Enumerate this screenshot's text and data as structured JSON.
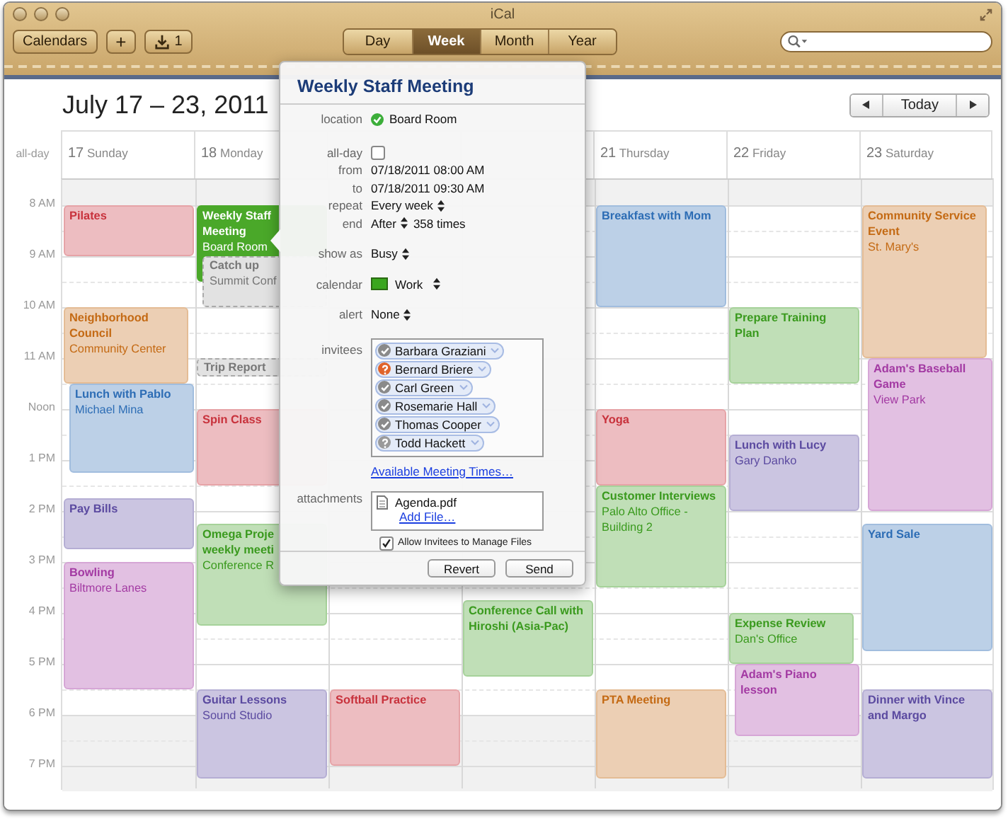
{
  "window": {
    "title": "iCal"
  },
  "toolbar": {
    "calendars": "Calendars",
    "add": "+",
    "inbox_count": "1",
    "views": [
      {
        "label": "Day",
        "selected": false
      },
      {
        "label": "Week",
        "selected": true
      },
      {
        "label": "Month",
        "selected": false
      },
      {
        "label": "Year",
        "selected": false
      }
    ]
  },
  "range_title": "July 17 – 23, 2011",
  "today": "Today",
  "allday_label": "all-day",
  "times": [
    "8 AM",
    "9 AM",
    "10 AM",
    "11 AM",
    "Noon",
    "1 PM",
    "2 PM",
    "3 PM",
    "4 PM",
    "5 PM",
    "6 PM",
    "7 PM"
  ],
  "days": [
    {
      "number": "17",
      "name": "Sunday",
      "events": [
        {
          "title": "Pilates",
          "color": "#c8323c",
          "kind": "normal"
        },
        {
          "title": "Neighborhood Council",
          "location": "Community Center",
          "color": "#c46a14",
          "kind": "normal"
        },
        {
          "title": "Lunch with Pablo",
          "location": "Michael Mina",
          "color": "#2d6db5",
          "kind": "normal"
        },
        {
          "title": "Pay Bills",
          "color": "#5b4aa0",
          "kind": "normal"
        },
        {
          "title": "Bowling",
          "location": "Biltmore Lanes",
          "color": "#a33aa3",
          "kind": "normal"
        }
      ]
    },
    {
      "number": "18",
      "name": "Monday",
      "events": [
        {
          "title": "Weekly Staff Meeting",
          "location": "Board Room",
          "color": "#4aa829",
          "kind": "selected"
        },
        {
          "title": "Catch up",
          "location": "Summit Conf",
          "color": "#777777",
          "kind": "pending"
        },
        {
          "title": "Trip Report",
          "color": "#777777",
          "kind": "pending"
        },
        {
          "title": "Spin Class",
          "color": "#c8323c",
          "kind": "normal"
        },
        {
          "title": "Omega Proje\nweekly meeti",
          "location": "Conference R",
          "color": "#3a9a1e",
          "kind": "normal"
        },
        {
          "title": "Guitar Lessons",
          "location": "Sound Studio",
          "color": "#5b4aa0",
          "kind": "normal"
        }
      ]
    },
    {
      "events": [
        {
          "title": "Softball Practice",
          "color": "#c8323c",
          "kind": "normal"
        }
      ]
    },
    {
      "events": [
        {
          "title": "Conference Call with Hiroshi (Asia-Pac)",
          "color": "#3a9a1e",
          "kind": "normal"
        }
      ]
    },
    {
      "number": "21",
      "name": "Thursday",
      "events": [
        {
          "title": "Breakfast with Mom",
          "color": "#2d6db5",
          "kind": "normal"
        },
        {
          "title": "Yoga",
          "color": "#c8323c",
          "kind": "normal"
        },
        {
          "title": "Customer Interviews",
          "location": "Palo Alto Office - Building 2",
          "color": "#3a9a1e",
          "kind": "normal"
        },
        {
          "title": "PTA Meeting",
          "color": "#c46a14",
          "kind": "normal"
        }
      ]
    },
    {
      "number": "22",
      "name": "Friday",
      "events": [
        {
          "title": "Prepare Training Plan",
          "color": "#3a9a1e",
          "kind": "normal"
        },
        {
          "title": "Lunch with Lucy",
          "location": "Gary Danko",
          "color": "#5b4aa0",
          "kind": "normal"
        },
        {
          "title": "Expense Review",
          "location": "Dan's Office",
          "color": "#3a9a1e",
          "kind": "normal"
        },
        {
          "title": "Adam's Piano lesson",
          "color": "#a33aa3",
          "kind": "normal"
        }
      ]
    },
    {
      "number": "23",
      "name": "Saturday",
      "events": [
        {
          "title": "Community Service Event",
          "location": "St. Mary's",
          "color": "#c46a14",
          "kind": "normal"
        },
        {
          "title": "Adam's Baseball Game",
          "location": "View Park",
          "color": "#a33aa3",
          "kind": "normal"
        },
        {
          "title": "Yard Sale",
          "color": "#2d6db5",
          "kind": "normal"
        },
        {
          "title": "Dinner with Vince and Margo",
          "color": "#5b4aa0",
          "kind": "normal"
        }
      ]
    }
  ],
  "popover": {
    "title": "Weekly Staff Meeting",
    "sections": [
      {
        "rows": [
          {
            "label": "location",
            "kind": "location",
            "value": "Board Room",
            "confirmed": true
          }
        ]
      },
      {
        "rows": [
          {
            "label": "all-day",
            "kind": "checkbox",
            "checked": false
          },
          {
            "label": "from",
            "kind": "text",
            "value": "07/18/2011 08:00 AM"
          },
          {
            "label": "to",
            "kind": "text",
            "value": "07/18/2011 09:30 AM"
          },
          {
            "label": "repeat",
            "kind": "popup",
            "value": "Every week"
          },
          {
            "label": "end",
            "kind": "popup",
            "value": "After",
            "extra": "358 times"
          }
        ]
      },
      {
        "rows": [
          {
            "label": "show as",
            "kind": "popup",
            "value": "Busy"
          }
        ]
      },
      {
        "rows": [
          {
            "label": "calendar",
            "kind": "calendar",
            "value": "Work",
            "color": "#3aa61e"
          }
        ]
      },
      {
        "rows": [
          {
            "label": "alert",
            "kind": "popup",
            "value": "None"
          }
        ]
      }
    ],
    "invitees": {
      "label": "invitees",
      "people": [
        {
          "name": "Barbara Graziani",
          "kind": "accepted"
        },
        {
          "name": "Bernard Briere",
          "kind": "maybe"
        },
        {
          "name": "Carl Green",
          "kind": "accepted"
        },
        {
          "name": "Rosemarie Hall",
          "kind": "accepted"
        },
        {
          "name": "Thomas Cooper",
          "kind": "accepted"
        },
        {
          "name": "Todd Hackett",
          "kind": "pending"
        }
      ],
      "link": "Available Meeting Times…"
    },
    "attachments": {
      "label": "attachments",
      "files": [
        "Agenda.pdf"
      ],
      "link": "Add File…",
      "allow": {
        "label": "Allow Invitees to Manage Files",
        "checked": true
      }
    },
    "buttons": [
      "Revert",
      "Send"
    ]
  }
}
